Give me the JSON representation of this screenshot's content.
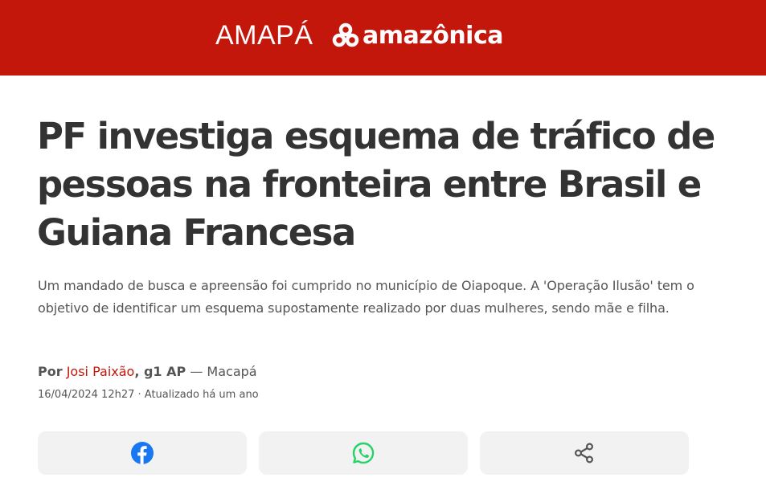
{
  "header": {
    "region": "AMAPÁ",
    "brand": "amazônica",
    "background": "#c4170c"
  },
  "article": {
    "title": "PF investiga esquema de tráfico de pessoas na fronteira entre Brasil e Guiana Francesa",
    "subtitle": "Um mandado de busca e apreensão foi cumprido no município de Oiapoque. A 'Operação Ilusão' tem o objetivo de identificar um esquema supostamente realizado por duas mulheres, sendo mãe e filha.",
    "byline": {
      "prefix": "Por",
      "author": "Josi Paixão",
      "outlet": ", g1 AP",
      "location": " — Macapá"
    },
    "dateline": "16/04/2024 12h27 · Atualizado há um ano"
  },
  "share": {
    "buttons": [
      {
        "network": "facebook",
        "icon": "facebook-icon",
        "color": "#1877f2"
      },
      {
        "network": "whatsapp",
        "icon": "whatsapp-icon",
        "color": "#25d366"
      },
      {
        "network": "share",
        "icon": "share-icon",
        "color": "#555555"
      }
    ]
  }
}
